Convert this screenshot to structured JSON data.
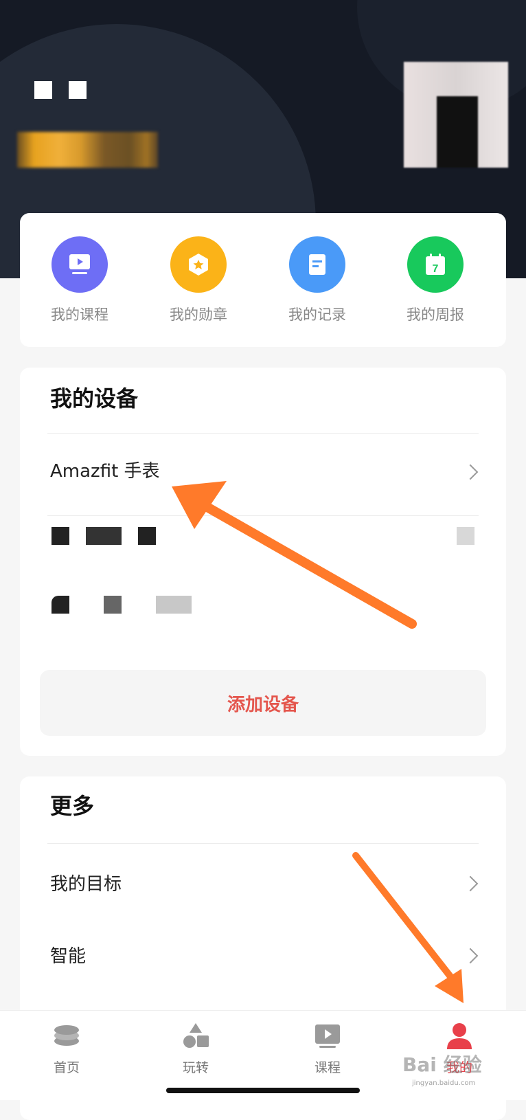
{
  "quick_actions": [
    {
      "label": "我的课程",
      "icon": "course-play-icon",
      "color": "#6e6ef5"
    },
    {
      "label": "我的勋章",
      "icon": "medal-star-icon",
      "color": "#fbb318"
    },
    {
      "label": "我的记录",
      "icon": "record-doc-icon",
      "color": "#4a9af8"
    },
    {
      "label": "我的周报",
      "icon": "calendar-7-icon",
      "color": "#18c95c",
      "calendar_day": "7"
    }
  ],
  "devices": {
    "title": "我的设备",
    "items": [
      {
        "label": "Amazfit 手表"
      }
    ],
    "add_button": "添加设备"
  },
  "more": {
    "title": "更多",
    "items": [
      {
        "label": "我的目标"
      },
      {
        "label": "智能"
      }
    ]
  },
  "tabbar": {
    "items": [
      {
        "label": "首页",
        "icon": "home-coins-icon"
      },
      {
        "label": "玩转",
        "icon": "shapes-icon"
      },
      {
        "label": "课程",
        "icon": "play-video-icon"
      },
      {
        "label": "我的",
        "icon": "profile-icon",
        "active": true
      }
    ]
  },
  "watermark": {
    "text": "Bai 经验",
    "sub": "jingyan.baidu.com"
  },
  "colors": {
    "accent": "#e8404a",
    "arrow": "#ff7a2a",
    "header_bg": "#151a25"
  }
}
